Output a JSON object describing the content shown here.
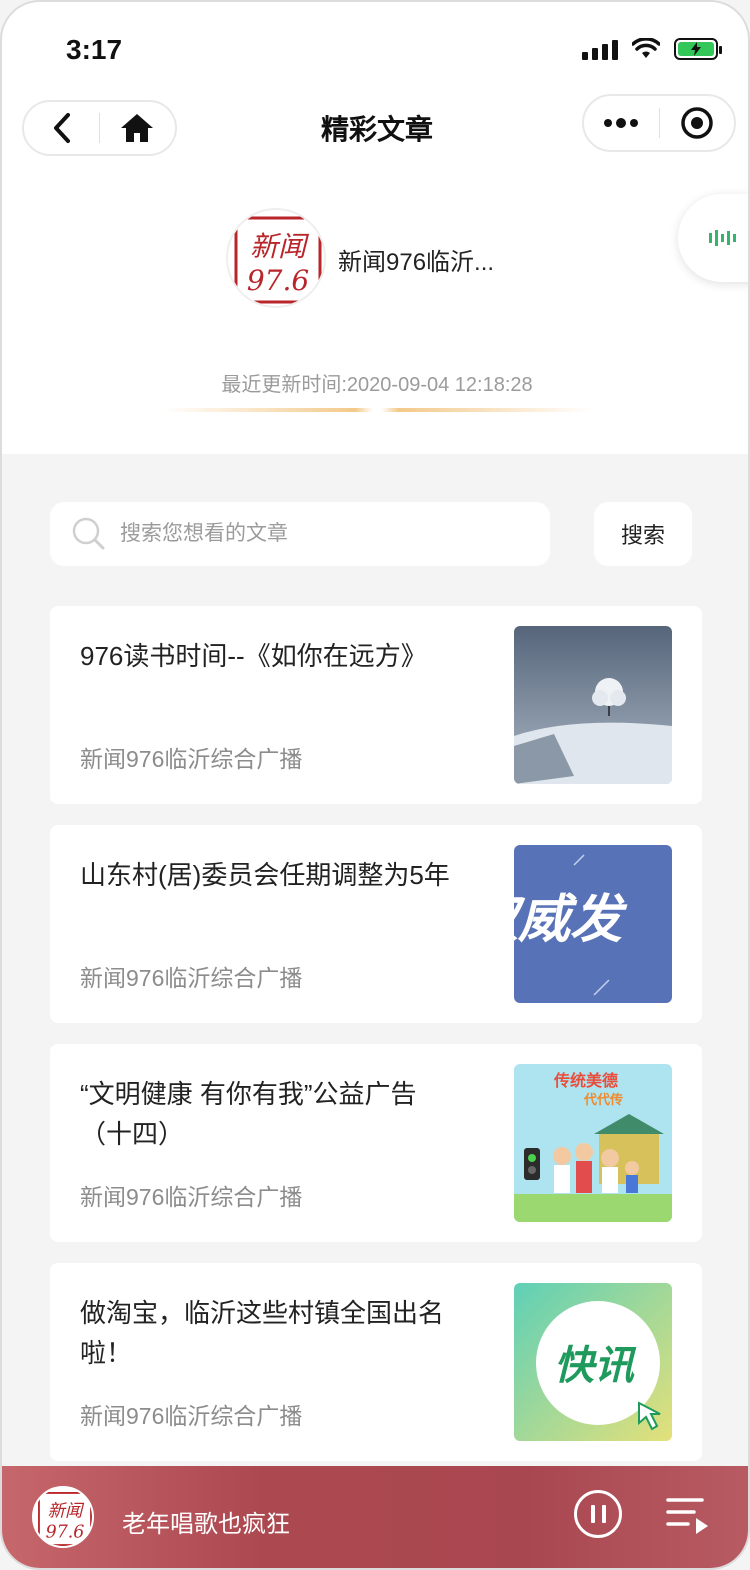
{
  "status_bar": {
    "time": "3:17"
  },
  "nav": {
    "title": "精彩文章"
  },
  "account": {
    "logo_text_line1": "新闻",
    "logo_text_line2": "97.6",
    "name": "新闻976临沂...",
    "update_time": "最近更新时间:2020-09-04 12:18:28"
  },
  "search": {
    "placeholder": "搜索您想看的文章",
    "button_label": "搜索"
  },
  "articles": [
    {
      "title": "976读书时间--《如你在远方》",
      "source": "新闻976临沂综合广播",
      "thumb": "snow-tree-thumbnail"
    },
    {
      "title": "山东村(居)委员会任期调整为5年",
      "source": "新闻976临沂综合广播",
      "thumb": "blue-text-thumbnail"
    },
    {
      "title": "“文明健康 有你有我”公益广告（十四）",
      "source": "新闻976临沂综合广播",
      "thumb": "cartoon-family-thumbnail"
    },
    {
      "title": "做淘宝，临沂这些村镇全国出名啦！",
      "source": "新闻976临沂综合广播",
      "thumb": "kuaixun-thumbnail"
    }
  ],
  "thumb_text": {
    "blue": "权威发",
    "cartoon": "传统美德",
    "cartoon_sub": "代代传",
    "kuaixun": "快讯"
  },
  "player": {
    "title": "老年唱歌也疯狂"
  },
  "colors": {
    "accent_gold": "#f3c98a",
    "player_red": "#a94750",
    "logo_red": "#b8262b"
  }
}
